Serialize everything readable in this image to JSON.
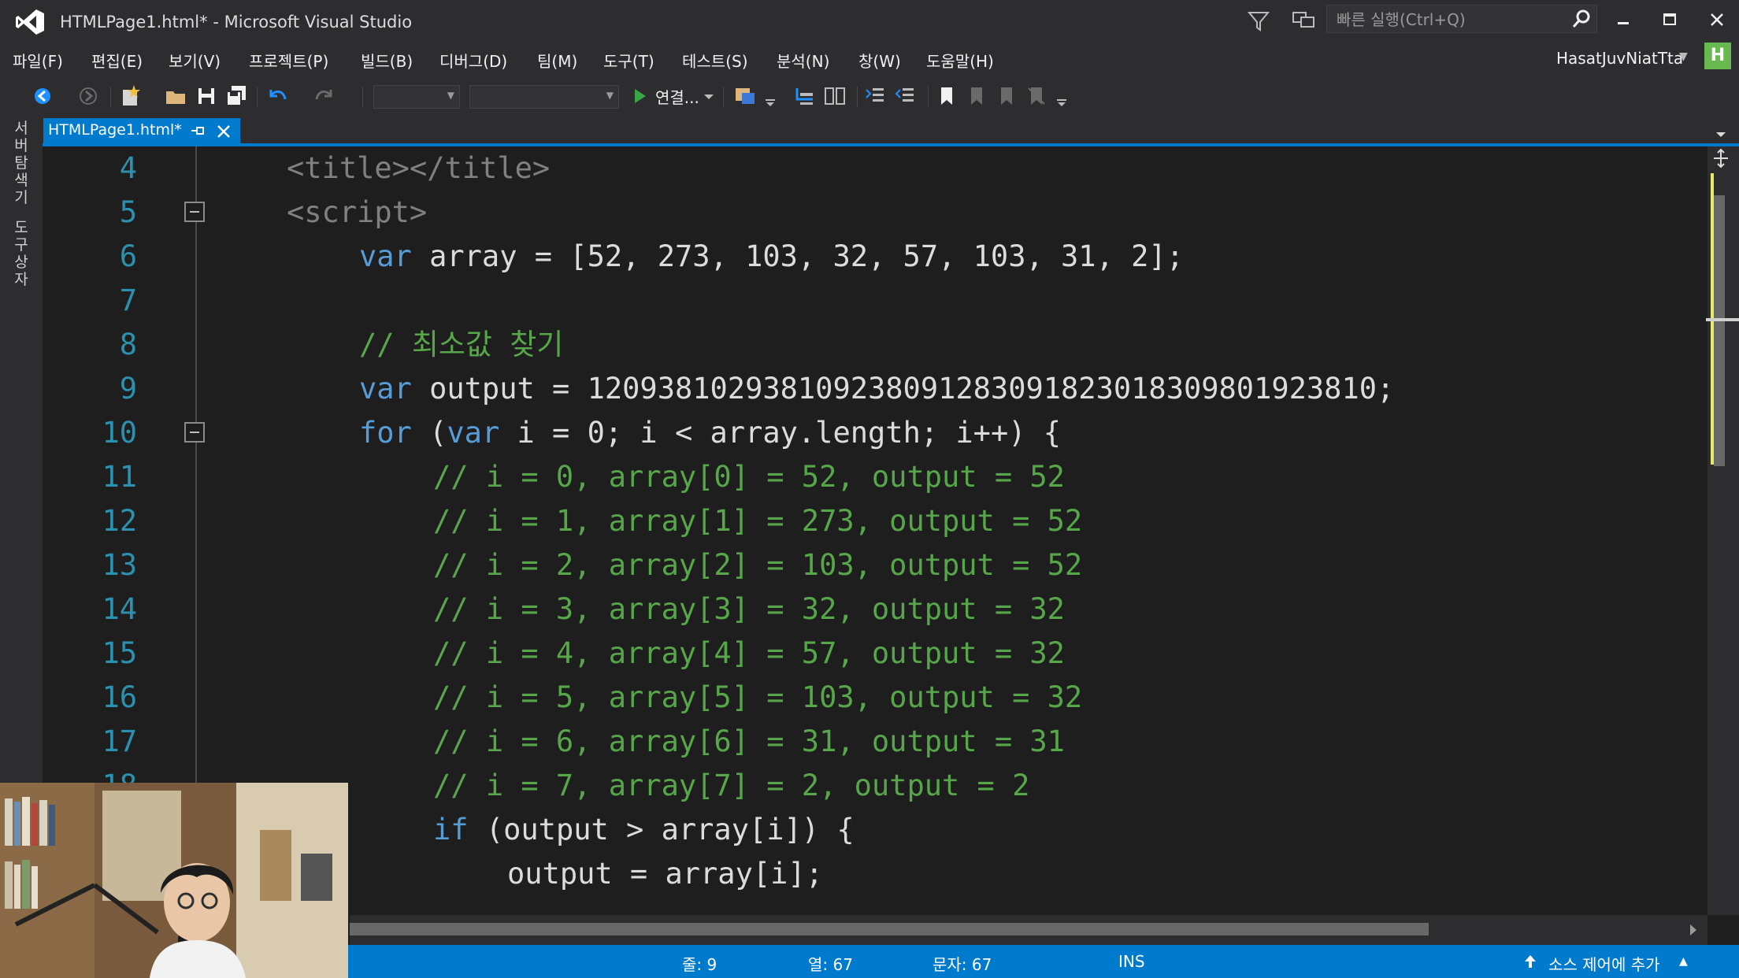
{
  "window": {
    "title": "HTMLPage1.html* - Microsoft Visual Studio",
    "icon": "visual-studio-logo-icon"
  },
  "quick_launch": {
    "placeholder": "빠른 실행(Ctrl+Q)"
  },
  "menu": {
    "items": [
      "파일(F)",
      "편집(E)",
      "보기(V)",
      "프로젝트(P)",
      "빌드(B)",
      "디버그(D)",
      "팀(M)",
      "도구(T)",
      "테스트(S)",
      "분석(N)",
      "창(W)",
      "도움말(H)"
    ]
  },
  "account": {
    "name": "HasatJuvNiatTta",
    "badge": "H",
    "badge_color": "#68b94f"
  },
  "toolbar": {
    "connect_label": "연결..."
  },
  "side_panels": [
    "서버 탐색기",
    "도구 상자"
  ],
  "tab": {
    "label": "HTMLPage1.html*"
  },
  "code": {
    "line_numbers": [
      "4",
      "5",
      "6",
      "7",
      "8",
      "9",
      "10",
      "11",
      "12",
      "13",
      "14",
      "15",
      "16",
      "17",
      "18"
    ],
    "lines": {
      "l4": {
        "open": "<title>",
        "close": "</title>"
      },
      "l5": {
        "tag": "<script>"
      },
      "l6": {
        "kw": "var",
        "rest": " array = [52, 273, 103, 32, 57, 103, 31, 2];"
      },
      "l8": {
        "comment": "// 최소값 찾기"
      },
      "l9": {
        "kw": "var",
        "rest": " output = 1209381029381092380912830918230183098019238​10;"
      },
      "l10": {
        "kw1": "for",
        "mid1": " (",
        "kw2": "var",
        "rest": " i = 0; i < array.length; i++) {"
      },
      "comments": [
        "// i = 0, array[0] = 52, output = 52",
        "// i = 1, array[1] = 273, output = 52",
        "// i = 2, array[2] = 103, output = 52",
        "// i = 3, array[3] = 32, output = 32",
        "// i = 4, array[4] = 57, output = 32",
        "// i = 5, array[5] = 103, output = 32",
        "// i = 6, array[6] = 31, output = 31",
        "// i = 7, array[7] = 2, output = 2"
      ],
      "l19": {
        "kw": "if",
        "rest": " (output > array[i]) {"
      },
      "l20": {
        "text": "output = array[i];"
      }
    }
  },
  "status": {
    "line": "줄: 9",
    "col": "열: 67",
    "char": "문자: 67",
    "mode": "INS",
    "source_control": "소스 제어에 추가"
  },
  "colors": {
    "accent": "#007acc",
    "keyword": "#569cd6",
    "comment": "#57a64a",
    "line_number": "#2b91af"
  }
}
